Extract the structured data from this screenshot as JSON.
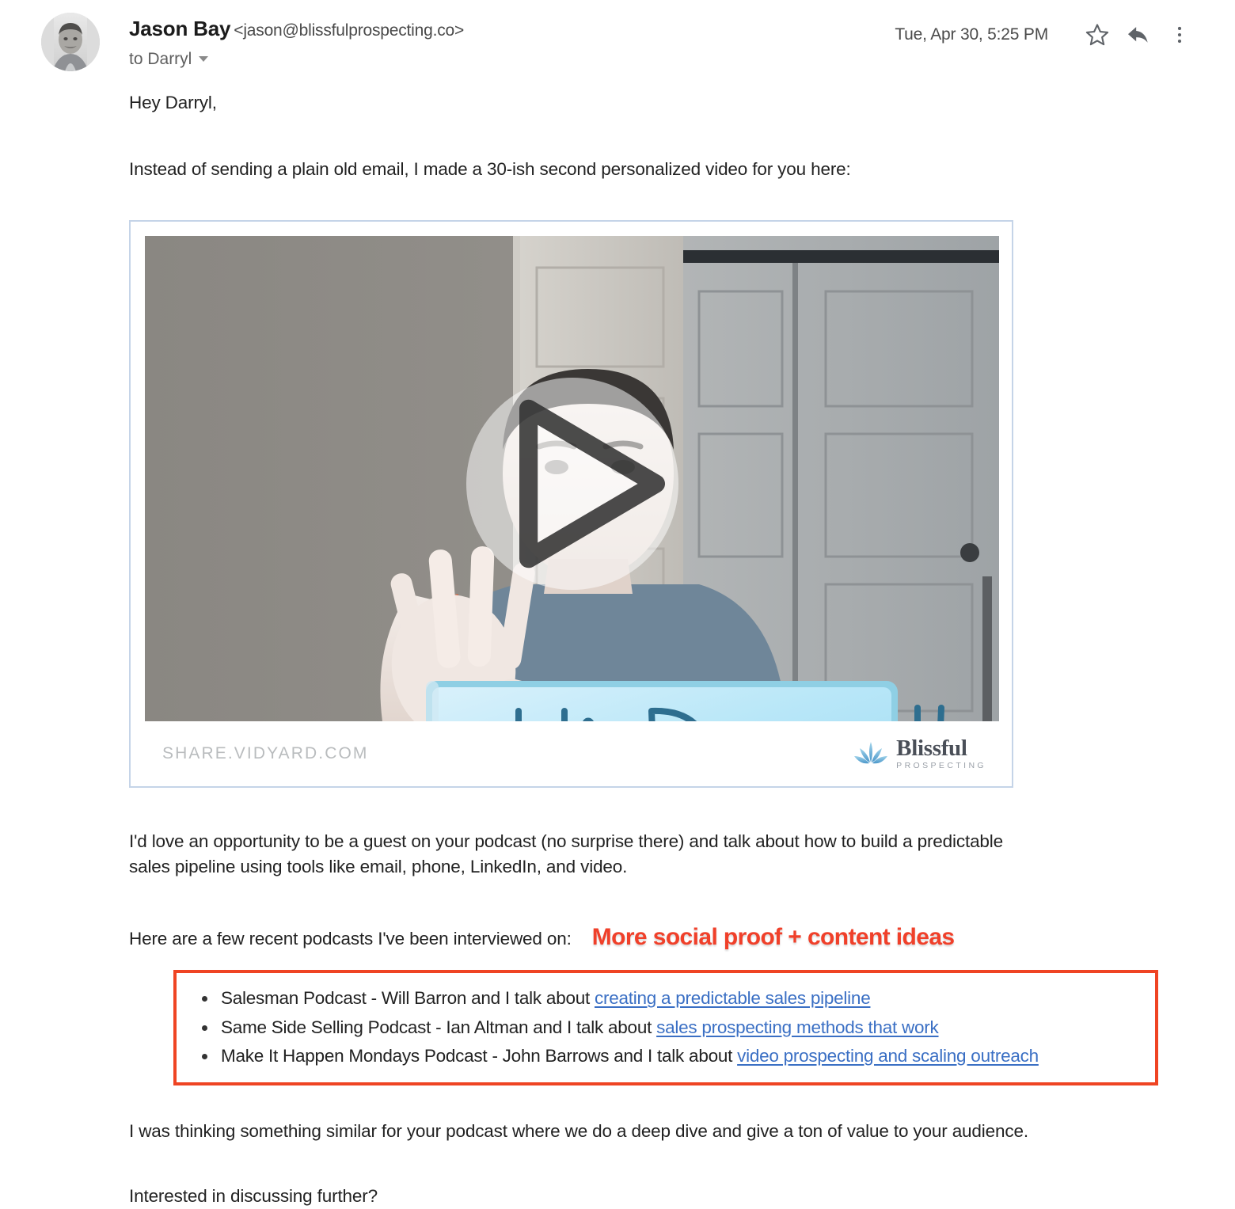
{
  "header": {
    "sender_name": "Jason Bay",
    "sender_email": "<jason@blissfulprospecting.co>",
    "recipient": "to Darryl",
    "timestamp": "Tue, Apr 30, 5:25 PM",
    "icons": {
      "star": "star-icon",
      "reply": "reply-icon",
      "more": "more-vertical-icon"
    },
    "avatar_alt": "Jason Bay profile photo"
  },
  "body": {
    "greeting": "Hey Darryl,",
    "intro": "Instead of sending a plain old email, I made a 30-ish second personalized video for you here:",
    "pitch_line1": "I'd love an opportunity to be a guest on your podcast (no surprise there) and talk about how to build a predictable",
    "pitch_line2": "sales pipeline using tools like email, phone, LinkedIn, and video.",
    "podcast_intro": "Here are a few recent podcasts I've been interviewed on:",
    "annotation": "More social proof + content ideas",
    "closing1": "I was thinking something similar for your podcast where we do a deep dive and give a ton of value to your audience.",
    "closing2": "Interested in discussing further?"
  },
  "video": {
    "whiteboard_text": "Hi Darryl!",
    "play_button": "play-icon",
    "source_label": "SHARE.VIDYARD.COM",
    "brand_name": "Blissful",
    "brand_sub": "PROSPECTING",
    "scene_description": "Man waving at camera holding a light blue whiteboard in front of closet doors"
  },
  "podcasts": [
    {
      "prefix": "Salesman Podcast - Will Barron and I talk about ",
      "link": "creating a predictable sales pipeline"
    },
    {
      "prefix": "Same Side Selling Podcast - Ian Altman and I talk about ",
      "link": "sales prospecting methods that work"
    },
    {
      "prefix": "Make It Happen Mondays Podcast - John Barrows and I talk about ",
      "link": "video prospecting and scaling outreach"
    }
  ],
  "colors": {
    "annotation_red": "#f0402a",
    "box_border_red": "#ef4423",
    "link_blue": "#3a6fc4",
    "card_border": "#c5d4e8"
  }
}
